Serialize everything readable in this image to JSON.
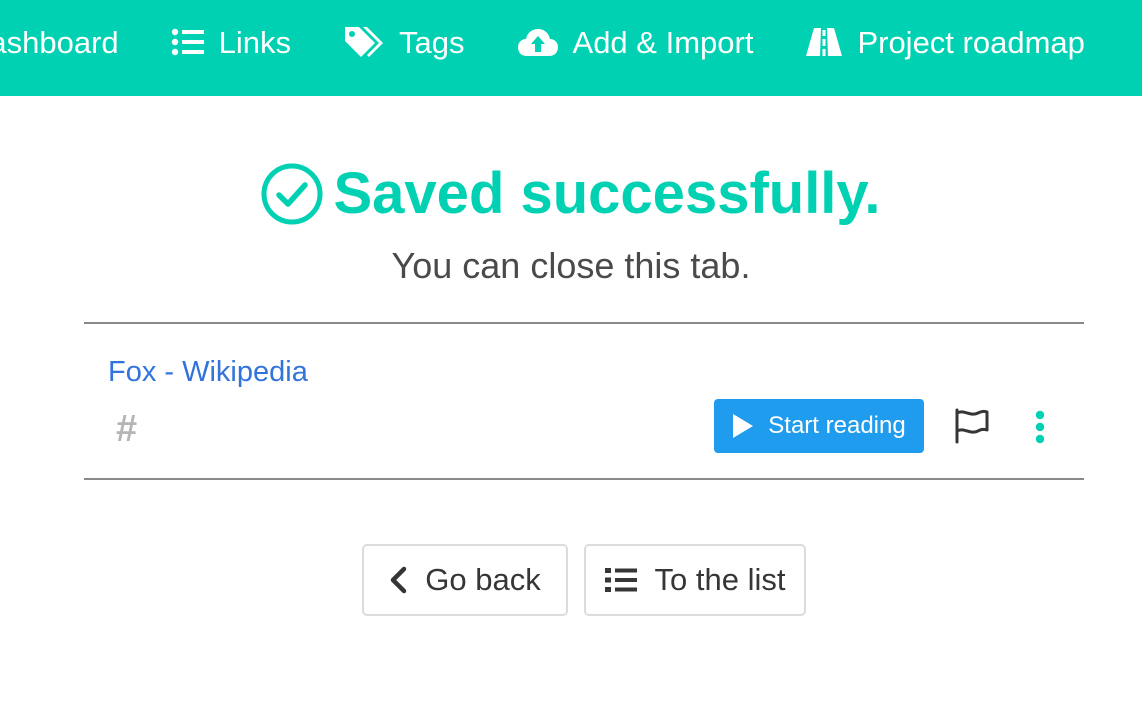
{
  "navbar": {
    "background": "#00d1b2",
    "items": [
      {
        "label": "Dashboard",
        "icon": "dashboard-icon"
      },
      {
        "label": "Links",
        "icon": "list-icon"
      },
      {
        "label": "Tags",
        "icon": "tags-icon"
      },
      {
        "label": "Add & Import",
        "icon": "cloud-upload-icon"
      },
      {
        "label": "Project roadmap",
        "icon": "road-icon"
      }
    ]
  },
  "hero": {
    "title": "Saved successfully.",
    "subtitle": "You can close this tab.",
    "accent_color": "#00d1b2"
  },
  "link": {
    "title": "Fox - Wikipedia",
    "tag_symbol": "#",
    "start_reading_label": "Start reading",
    "title_color": "#3273dc",
    "button_color": "#209cee"
  },
  "actions": {
    "go_back_label": "Go back",
    "to_list_label": "To the list"
  }
}
